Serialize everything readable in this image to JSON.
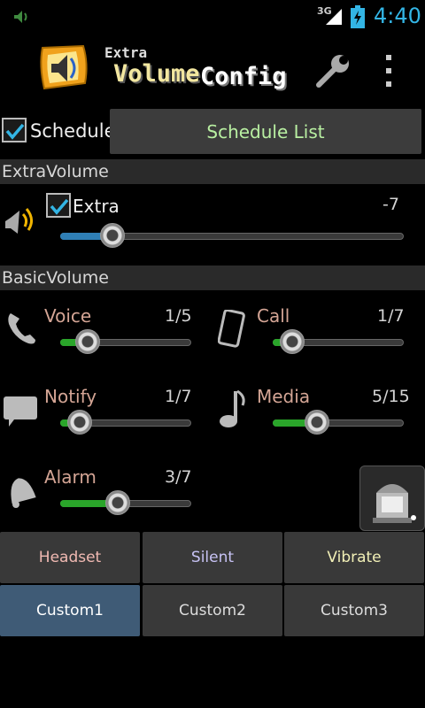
{
  "status_bar": {
    "network": "3G",
    "time": "4:40"
  },
  "header": {
    "title_small": "Extra",
    "title_main": "Volume",
    "title_second": "Config"
  },
  "schedule": {
    "checkbox_label": "Schedule",
    "checked": true,
    "list_button": "Schedule List"
  },
  "sections": {
    "extra": "ExtraVolume",
    "basic": "BasicVolume"
  },
  "extra": {
    "checkbox_label": "Extra",
    "checked": true,
    "value_text": "-7",
    "level_fraction": 0.15
  },
  "volumes": [
    {
      "label": "Voice",
      "value_text": "1/5",
      "level_fraction": 0.2
    },
    {
      "label": "Call",
      "value_text": "1/7",
      "level_fraction": 0.14
    },
    {
      "label": "Notify",
      "value_text": "1/7",
      "level_fraction": 0.14
    },
    {
      "label": "Media",
      "value_text": "5/15",
      "level_fraction": 0.33
    },
    {
      "label": "Alarm",
      "value_text": "3/7",
      "level_fraction": 0.43
    }
  ],
  "mode_buttons": [
    {
      "label": "Headset",
      "color": "#f0b9b2"
    },
    {
      "label": "Silent",
      "color": "#c7c2f4"
    },
    {
      "label": "Vibrate",
      "color": "#f1efb6"
    }
  ],
  "custom_buttons": [
    {
      "label": "Custom1",
      "active": true
    },
    {
      "label": "Custom2",
      "active": false
    },
    {
      "label": "Custom3",
      "active": false
    }
  ],
  "colors": {
    "accent_blue": "#33b5e5",
    "slider_green": "#2aa52a",
    "slider_blue": "#2f7fb5",
    "label_salmon": "#d4a595"
  },
  "icons": {
    "status_left": "speaker-notification-icon",
    "signal": "signal-bars-icon",
    "battery": "battery-charging-icon",
    "app_logo": "app-logo-speaker-icon",
    "settings": "wrench-icon",
    "menu": "overflow-menu-icon",
    "extra": "speaker-waves-icon",
    "voice": "phone-handset-icon",
    "call": "smartphone-icon",
    "notify": "speech-bubble-icon",
    "media": "music-note-icon",
    "alarm": "bell-icon",
    "widget": "cleaner-widget-icon"
  }
}
